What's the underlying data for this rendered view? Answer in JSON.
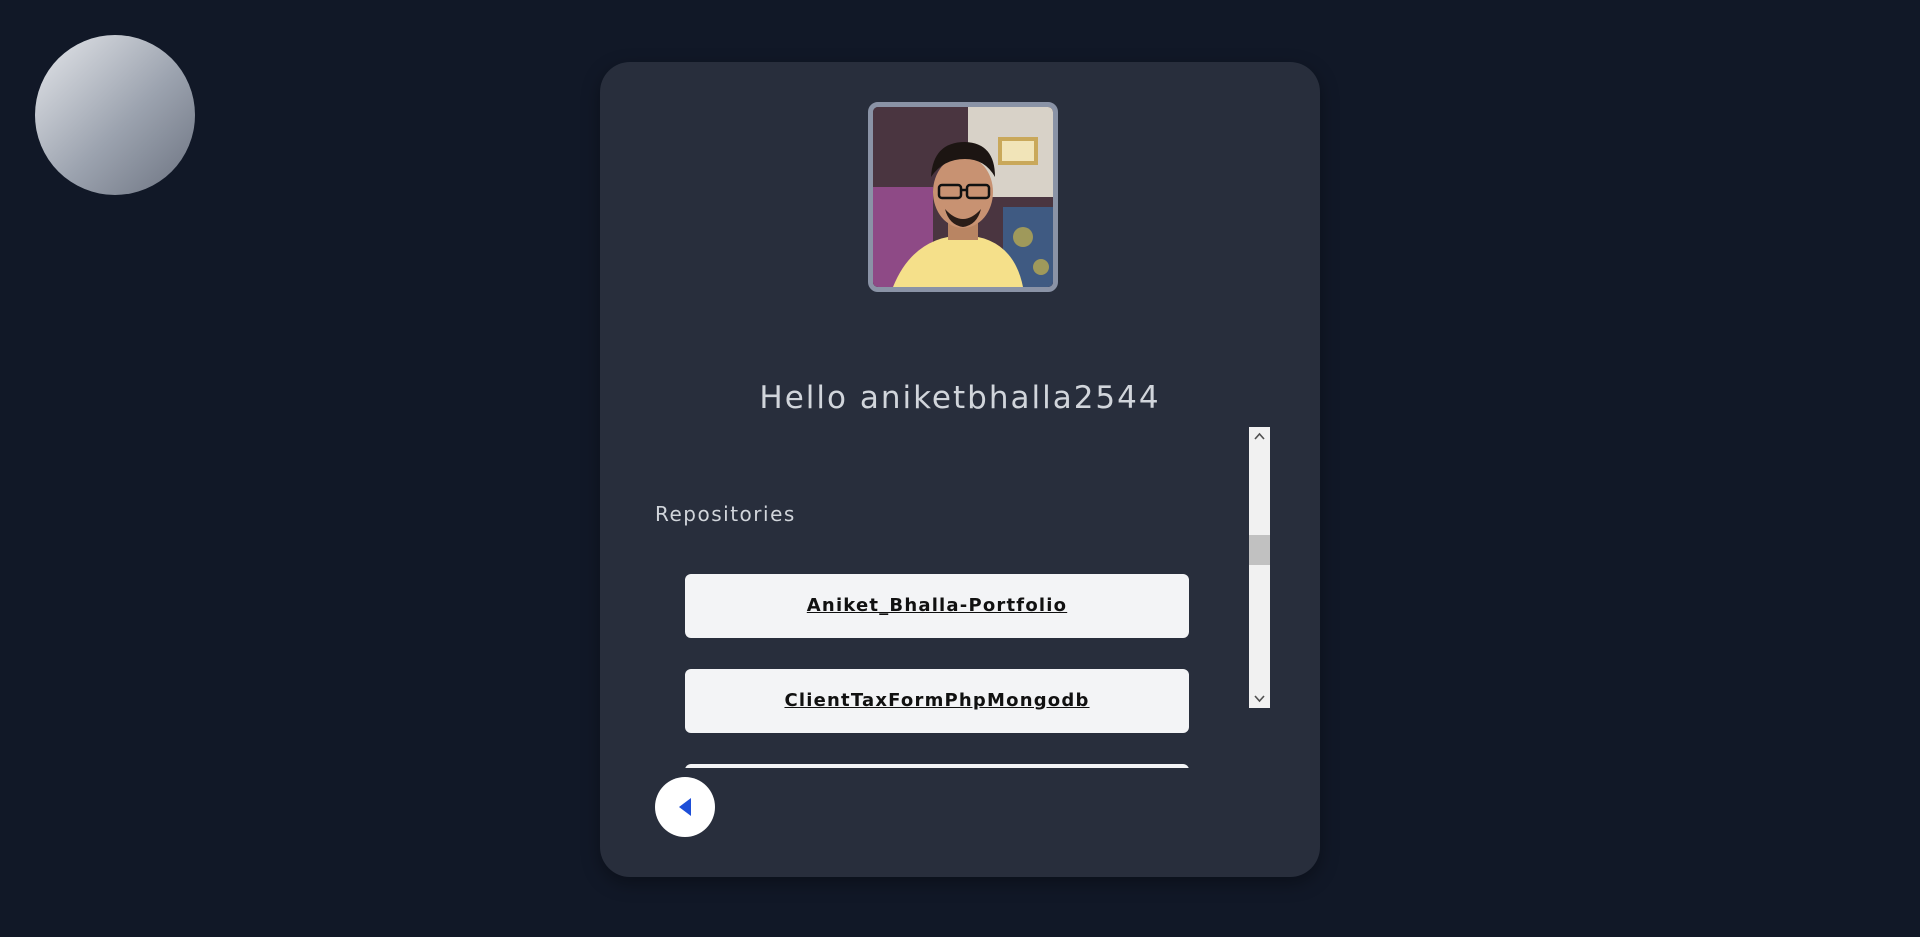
{
  "profile": {
    "greeting": "Hello aniketbhalla2544"
  },
  "repositories": {
    "title": "Repositories",
    "items": [
      {
        "label": "Aniket_Bhalla-Portfolio"
      },
      {
        "label": "ClientTaxFormPhpMongodb"
      },
      {
        "label": ""
      }
    ]
  },
  "colors": {
    "background": "#111827",
    "card": "#282e3c",
    "repo_item_bg": "#f3f4f6",
    "back_icon": "#1d4ed8"
  },
  "icons": {
    "back": "caret-left-icon",
    "scroll_up": "chevron-up-icon",
    "scroll_down": "chevron-down-icon"
  }
}
